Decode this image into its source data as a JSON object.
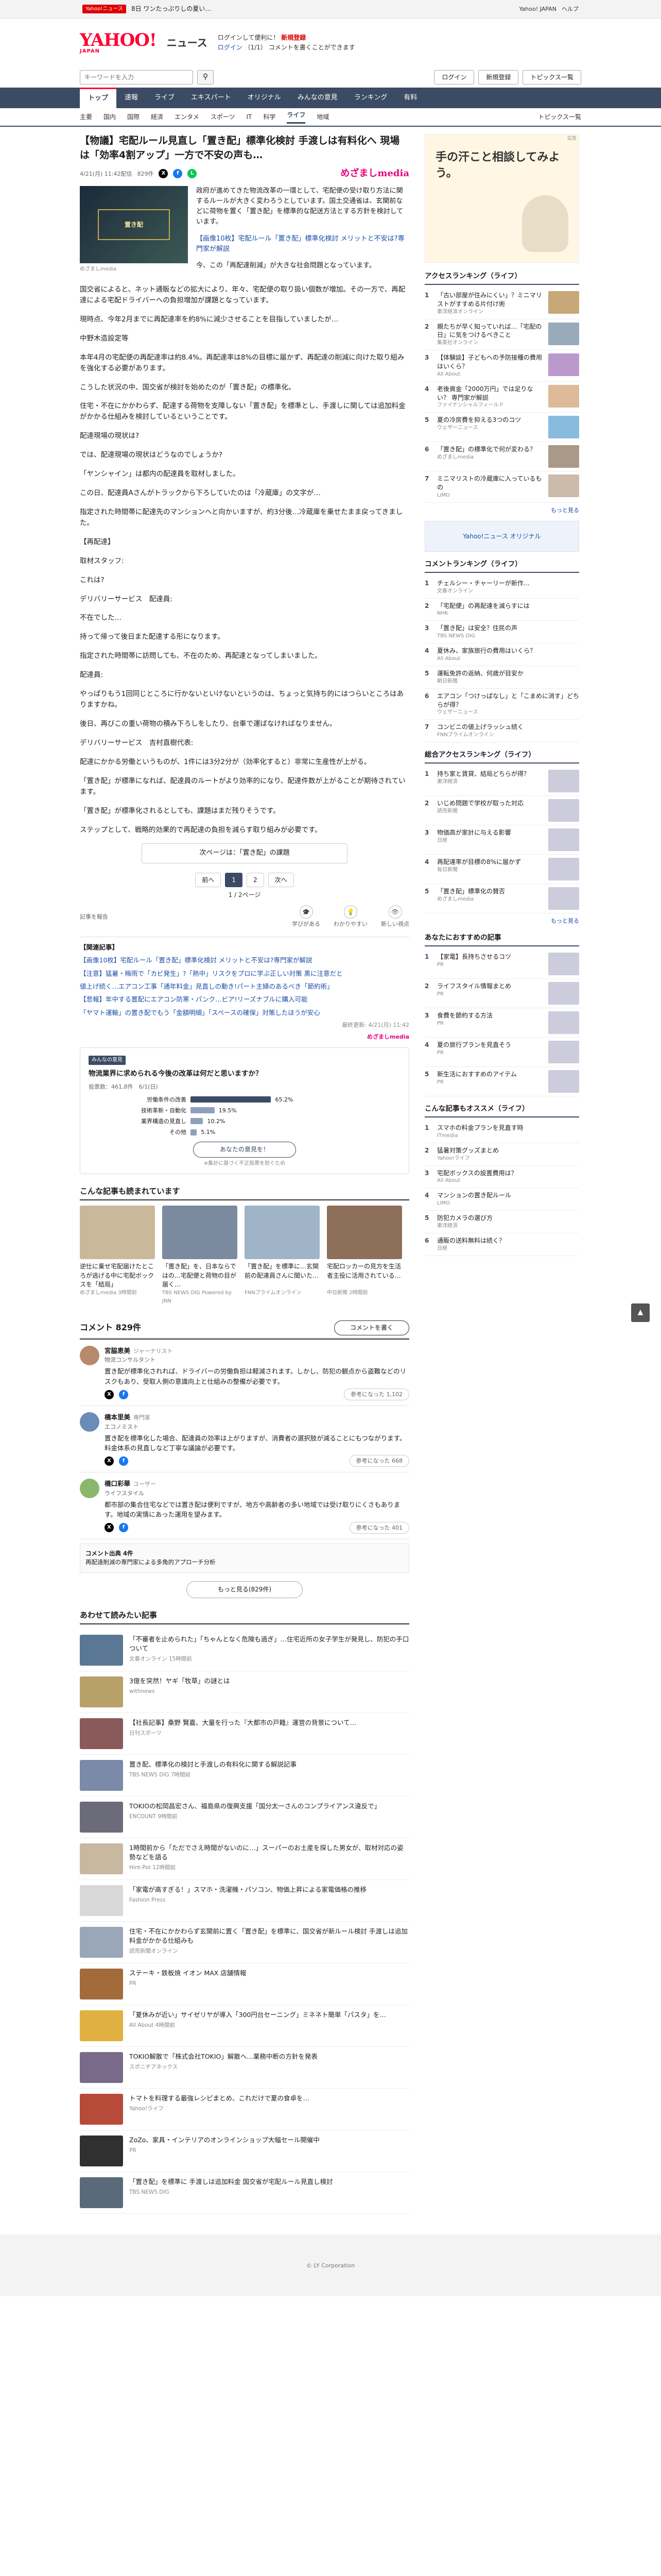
{
  "topbar": {
    "badge": "Yahoo!ニュース",
    "notice": "8日 ワンたっぷりしの夏い…",
    "links": [
      "Yahoo! JAPAN",
      "ヘルプ"
    ]
  },
  "header": {
    "logo": "YAHOO!",
    "logo_sub": "JAPAN",
    "service": "ニュース",
    "msg1": "ログインして便利に！",
    "msg1_bold": "新規登録",
    "msg2": "ログイン",
    "msg3": "（1/1） コメントを書くことができます"
  },
  "search": {
    "placeholder": "キーワードを入力",
    "buttons": [
      "ログイン",
      "新規登録"
    ],
    "tools": "トピックス一覧"
  },
  "mainnav": [
    "トップ",
    "速報",
    "ライブ",
    "エキスパート",
    "オリジナル",
    "みんなの意見",
    "ランキング",
    "有料"
  ],
  "subnav": [
    "主要",
    "国内",
    "国際",
    "経済",
    "エンタメ",
    "スポーツ",
    "IT",
    "科学",
    "ライフ",
    "地域"
  ],
  "subnav_active": "ライフ",
  "subnav_right": "トピックス一覧",
  "article": {
    "title": "【物議】宅配ルール見直し「置き配」標準化検討 手渡しは有料化へ 現場は「効率4割アップ」一方で不安の声も…",
    "date": "4/21(月) 11:42配信",
    "comments_count": "829件",
    "source": "めざましmedia",
    "image_caption": "めざましmedia",
    "image_plate": "置き配",
    "lead": [
      "政府が進めてきた物流改革の一環として、宅配便の受け取り方法に関するルールが大きく変わろうとしています。国土交通省は、玄関前などに荷物を置く「置き配」を標準的な配送方法とする方針を検討しています。",
      "【画像10枚】宅配ルール「置き配」標準化検討 メリットと不安は?専門家が解説"
    ],
    "lead_link": "【画像10枚】宅配ルール「置き配」標準化検討 メリットと不安は?専門家が解説",
    "lead_p3": "今、この「再配達削減」が大きな社会問題となっています。",
    "body": [
      "国交省によると、ネット通販などの拡大により、年々、宅配便の取り扱い個数が増加。その一方で、再配達による宅配ドライバーへの負担増加が課題となっています。",
      "現時点、今年2月までに再配達率を約8%に減少させることを目指していましたが…",
      "中野木造設定等",
      "本年4月の宅配便の再配達率は約8.4%。再配達率は8%の目標に届かず、再配達の削減に向けた取り組みを強化する必要があります。",
      "こうした状況の中、国交省が検討を始めたのが「置き配」の標準化。",
      "住宅・不在にかかわらず、配達する荷物を支障しない「置き配」を標準とし、手渡しに関しては追加料金がかかる仕組みを検討しているということです。",
      "配達現場の現状は?",
      "では、配達現場の現状はどうなのでしょうか?",
      "「ヤンシャイン」は都内の配達員を取材しました。",
      "この日、配達員Aさんがトラックから下ろしていたのは「冷蔵庫」の文字が…",
      "指定された時間帯に配達先のマンションへと向かいますが、約3分後…冷蔵庫を乗せたまま戻ってきました。",
      "【再配達】",
      "取材スタッフ:",
      "これは?",
      "デリバリーサービス　配達員:",
      "不在でした…",
      "持って帰って後日また配達する形になります。",
      "指定された時間帯に訪問しても、不在のため、再配達となってしまいました。",
      "配達員:",
      "やっぱりもう1回同じところに行かないといけないというのは、ちょっと気持ち的にはつらいところはありますかね。",
      "後日、再びこの重い荷物の積み下ろしをしたり、台車で運ばなければなりません。",
      "デリバリーサービス　吉村直樹代表:",
      "配達にかかる労働というものが、1件には3分2分が（効率化すると）非常に生産性が上がる。",
      "「置き配」が標準になれば、配達員のルートがより効率的になり、配達件数が上がることが期待されています。",
      "「置き配」が標準化されるとしても、課題はまだ残りそうです。",
      "ステップとして、戦略的効果的で再配達の負担を減らす取り組みが必要です。"
    ],
    "body_link": "次ページは：「置き配」の課題",
    "pager": {
      "prev": "前へ",
      "pages": [
        "1",
        "2"
      ],
      "next": "次へ",
      "indicator": "1 / 2ページ"
    },
    "reactions": [
      "学びがある",
      "わかりやすい",
      "新しい視点"
    ],
    "report": "記事を報告",
    "related_head": "【関連記事】",
    "related": [
      "【画像10枚】宅配ルール「置き配」標準化検討 メリットと不安は?専門家が解説",
      "【注意】猛暑・梅雨で「カビ発生」?「熱中」リスクをプロに学ぶ正しい対策 黒に注意だと",
      "値上げ続く…エアコン工事「通年料金」見直しの動き!パート主婦のあるべき「節約術」",
      "【悲報】年中する置配にエアコン防寒・パンク…ビア!リーズナブルに購入可能",
      "「ヤマト運輸」の置き配でもう「金額明細」「スペースの確保」対策したほうが安心"
    ],
    "updated": "最終更新: 4/21(月) 11:42",
    "footer_source": "めざましmedia"
  },
  "poll": {
    "tag": "みんなの意見",
    "question": "物流業界に求められる今後の改革は何だと思いますか？",
    "meta": "投票数：461,8件　6/1(日)",
    "options": [
      {
        "label": "労働条件の改善",
        "pct": 65.2,
        "text": "65.2%"
      },
      {
        "label": "技術革新・自動化",
        "pct": 19.5,
        "text": "19.5%"
      },
      {
        "label": "業界構造の見直し",
        "pct": 10.2,
        "text": "10.2%"
      },
      {
        "label": "その他",
        "pct": 5.1,
        "text": "5.1%"
      }
    ],
    "button": "あなたの意見を！",
    "note": "※集計に基づく不正投票を防ぐため"
  },
  "also_read": {
    "title": "こんな記事も読まれています",
    "cards": [
      {
        "title": "逆仕に乗せ宅配届けたところが逃げる中に宅配ボックスを「結局」",
        "src": "めざましmedia 3時間前",
        "color": "#c9b89a"
      },
      {
        "title": "「置き配」を、日本ならではの…宅配便と荷物の目が届く…",
        "src": "TBS NEWS DIG Powered by JNN",
        "color": "#7c8aa0"
      },
      {
        "title": "「置き配」を標準に…玄関前の配達員さんに聞いた…",
        "src": "FNNプライムオンライン",
        "color": "#a0b4c8"
      },
      {
        "title": "宅配ロッカーの見方を生活者主役に活用されている…",
        "src": "中日新聞 2時間前",
        "color": "#8e6f5a"
      }
    ]
  },
  "comments": {
    "title": "コメント 829件",
    "post_button": "コメントを書く",
    "items": [
      {
        "name": "宮脇恵美",
        "meta": "ジャーナリスト",
        "role": "物流コンサルタント",
        "text": "置き配が標準化されれば、ドライバーの労働負担は軽減されます。しかし、防犯の観点から盗難などのリスクもあり、受取人側の意識向上と仕組みの整備が必要です。",
        "helpful": "参考になった 1,102",
        "color": "#b78a6b"
      },
      {
        "name": "橋本里美",
        "meta": "専門家",
        "role": "エコノミスト",
        "text": "置き配を標準化した場合、配達員の効率は上がりますが、消費者の選択肢が減ることにもつながります。料金体系の見直しなど丁寧な議論が必要です。",
        "helpful": "参考になった 668",
        "color": "#6b8cb7"
      },
      {
        "name": "橋口彩華",
        "meta": "ユーザー",
        "role": "ライフスタイル",
        "text": "都市部の集合住宅などでは置き配は便利ですが、地方や高齢者の多い地域では受け取りにくさもあります。地域の実情にあった運用を望みます。",
        "helpful": "参考になった 401",
        "color": "#8bb76b"
      }
    ],
    "compact_title": "コメント出典 4件",
    "compact_text": "再配達削減の専門家による多角的アプローチ分析",
    "more": "もっと見る(829件)",
    "hide_label": "非表示"
  },
  "read_also": {
    "title": "あわせて読みたい記事",
    "items": [
      {
        "title": "「不審者を止められた」「ちゃんとなく危険も過ぎ」…住宅近所の女子学生が発見し、防犯の手口ついて",
        "src": "文春オンライン 15時間前",
        "color": "#5a7894"
      },
      {
        "title": "3億を突然！ヤギ「牧草」の謎とは",
        "src": "withnews",
        "color": "#b8a069"
      },
      {
        "title": "【社長記事】桑野 賢嘉、大量を行った『大都市の戸籍』運営の背景について…",
        "src": "日刊スポーツ",
        "color": "#8a5a5a"
      },
      {
        "title": "置き配、標準化の検討と手渡しの有料化に関する解説記事",
        "src": "TBS NEWS DIG 7時間前",
        "color": "#7a8aa8"
      },
      {
        "title": "TOKIOの松岡昌宏さん、福島県の復興支援「国分太一さんのコンプライアンス違反で」",
        "src": "ENCOUNT 9時間前",
        "color": "#6b6b7a"
      },
      {
        "title": "1時間前から「ただでさえ時間がないのに…」スーパーのお土産を探した男女が、取材対応の姿勢などを語る",
        "src": "Hint-Pot 12時間前",
        "color": "#c8b8a0"
      },
      {
        "title": "「家電が高すぎる！」スマホ・洗濯機・パソコン、物価上昇による家電価格の推移",
        "src": "Fashion Press",
        "color": "#d8d8d8"
      },
      {
        "title": "住宅・不在にかかわらず玄関前に置く「置き配」を標準に、国交省が新ルール検討 手渡しは追加料金がかかる仕組みも",
        "src": "読売新聞オンライン",
        "color": "#9aa7b8"
      },
      {
        "title": "ステーキ・鉄板焼 イオン MAX 店舗情報",
        "src": "PR",
        "color": "#a36b3a"
      },
      {
        "title": "「夏休みが近い」サイゼリヤが導入「300円台セーニング」ミネネト簡単「パスタ」を…",
        "src": "All About 4時間前",
        "color": "#e0b040"
      },
      {
        "title": "TOKIO解散で「株式会社TOKIO」解散へ…業務中断の方針を発表",
        "src": "スポニチアネックス",
        "color": "#7a6a8a"
      },
      {
        "title": "トマトを料理する最強レシピまとめ、これだけで夏の食卓を…",
        "src": "Yahoo!ライフ",
        "color": "#b84a3a"
      },
      {
        "title": "ZoZo、家具・インテリアのオンラインショップ大幅セール開催中",
        "src": "PR",
        "color": "#303030"
      },
      {
        "title": "「置き配」を標準に 手渡しは追加料金 国交省が宅配ルール見直し検討",
        "src": "TBS NEWS DIG",
        "color": "#5a6a7a"
      }
    ]
  },
  "side": {
    "ad": {
      "text": "手の汗こと相談してみよう。",
      "label": "広告"
    },
    "access_title": "アクセスランキング（ライフ）",
    "access": [
      {
        "title": "「古い部屋が住みにくい」？ミニマリストがすすめる片付け術",
        "src": "東洋経済オンライン",
        "color": "#c8a878"
      },
      {
        "title": "親たちが早く知っていれば…「宅配の日」に気をつけるべきこと",
        "src": "集英社オンライン",
        "color": "#9ab"
      },
      {
        "title": "【体験談】子どもへの予防接種の費用はいくら？",
        "src": "All About",
        "color": "#b9c"
      },
      {
        "title": "老後資金「2000万円」では足りない？ 専門家が解説",
        "src": "ファイナンシャルフィールド",
        "color": "#db9"
      },
      {
        "title": "夏の冷房費を抑える3つのコツ",
        "src": "ウェザーニュース",
        "color": "#8bd"
      },
      {
        "title": "「置き配」の標準化で何が変わる？",
        "src": "めざましmedia",
        "color": "#a98"
      },
      {
        "title": "ミニマリストの冷蔵庫に入っているもの",
        "src": "LIMO",
        "color": "#cba"
      }
    ],
    "access_more": "もっと見る",
    "banner": "Yahoo!ニュース オリジナル",
    "comment_title": "コメントランキング（ライフ）",
    "comment_rank": [
      {
        "title": "チェルシー・チャーリーが新作…",
        "src": "文春オンライン"
      },
      {
        "title": "「宅配便」の再配達を減らすには",
        "src": "NHK"
      },
      {
        "title": "「置き配」は安全？住民の声",
        "src": "TBS NEWS DIG"
      },
      {
        "title": "夏休み、家族旅行の費用はいくら？",
        "src": "All About"
      },
      {
        "title": "運転免許の返納、何歳が目安か",
        "src": "朝日新聞"
      },
      {
        "title": "エアコン「つけっぱなし」と「こまめに消す」どちらが得？",
        "src": "ウェザーニュース"
      },
      {
        "title": "コンビニの値上げラッシュ続く",
        "src": "FNNプライムオンライン"
      }
    ],
    "top_title": "総合アクセスランキング（ライフ）",
    "top": [
      {
        "title": "持ち家と賃貸、結局どちらが得？",
        "src": "東洋経済"
      },
      {
        "title": "いじめ問題で学校が取った対応",
        "src": "読売新聞"
      },
      {
        "title": "物価高が家計に与える影響",
        "src": "日経"
      },
      {
        "title": "再配達率が目標の8%に届かず",
        "src": "毎日新聞"
      },
      {
        "title": "「置き配」標準化の賛否",
        "src": "めざましmedia"
      }
    ],
    "ranking_more": "もっと見る",
    "pr_title": "あなたにおすすめの記事",
    "pr": [
      {
        "title": "【家電】長持ちさせるコツ",
        "src": "PR"
      },
      {
        "title": "ライフスタイル情報まとめ",
        "src": "PR"
      },
      {
        "title": "食費を節約する方法",
        "src": "PR"
      },
      {
        "title": "夏の旅行プランを見直そう",
        "src": "PR"
      },
      {
        "title": "新生活におすすめのアイテム",
        "src": "PR"
      }
    ],
    "recommend_title": "こんな記事もオススメ（ライフ）",
    "recommend": [
      {
        "title": "スマホの料金プランを見直す時",
        "src": "ITmedia"
      },
      {
        "title": "猛暑対策グッズまとめ",
        "src": "Yahoo!ライフ"
      },
      {
        "title": "宅配ボックスの設置費用は？",
        "src": "All About"
      },
      {
        "title": "マンションの置き配ルール",
        "src": "LIMO"
      },
      {
        "title": "防犯カメラの選び方",
        "src": "東洋経済"
      },
      {
        "title": "通販の送料無料は続く？",
        "src": "日経"
      }
    ]
  },
  "footer": "© LY Corporation"
}
